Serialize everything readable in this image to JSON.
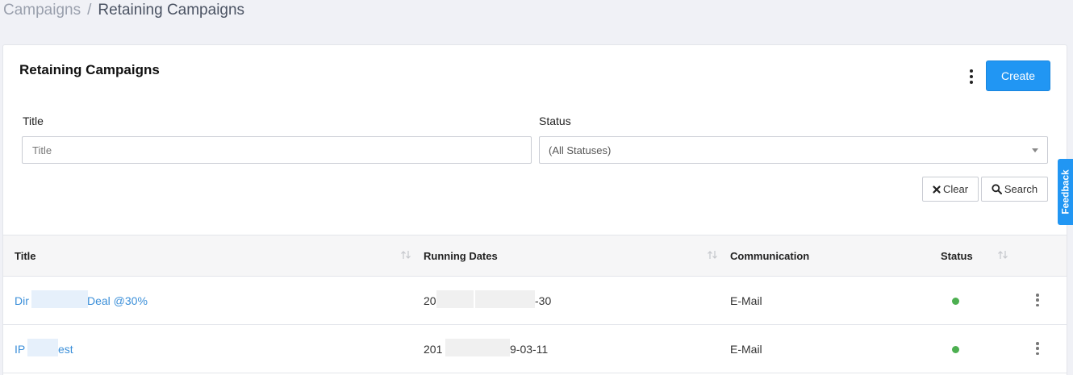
{
  "breadcrumb": {
    "parent": "Campaigns",
    "separator": "/",
    "current": "Retaining Campaigns"
  },
  "card": {
    "title": "Retaining Campaigns",
    "create_label": "Create"
  },
  "filters": {
    "title_label": "Title",
    "title_placeholder": "Title",
    "title_value": "",
    "status_label": "Status",
    "status_selected": "(All Statuses)",
    "clear_label": "Clear",
    "search_label": "Search"
  },
  "table": {
    "columns": [
      "Title",
      "Running Dates",
      "Communication",
      "Status"
    ],
    "rows": [
      {
        "title_start": "Dir",
        "title_end": "Deal @30%",
        "dates_start": "20",
        "dates_end": "-30",
        "communication": "E-Mail",
        "status": "active"
      },
      {
        "title_start": "IP",
        "title_end": "est",
        "dates_start": "201",
        "dates_end": "9-03-11",
        "communication": "E-Mail",
        "status": "active"
      }
    ]
  },
  "feedback": {
    "label": "Feedback"
  },
  "colors": {
    "accent": "#2196f3",
    "link": "#3b8fd9",
    "status_active": "#4caf50"
  },
  "icons": {
    "sort": "sort-arrows-icon",
    "clear": "close-icon",
    "search": "search-icon",
    "menu": "kebab-icon",
    "select": "chevron-down-icon"
  }
}
